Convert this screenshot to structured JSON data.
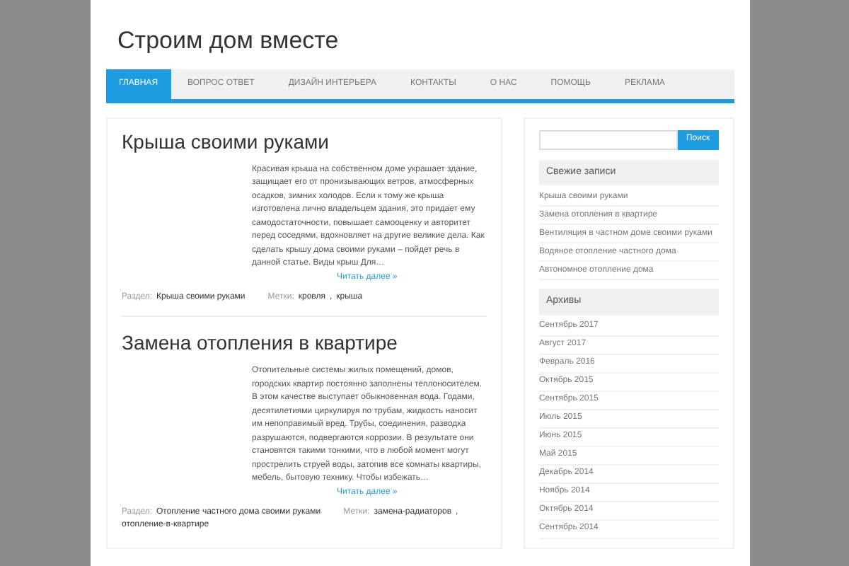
{
  "site_title": "Строим дом вместе",
  "nav": [
    {
      "label": "ГЛАВНАЯ",
      "selected": true
    },
    {
      "label": "ВОПРОС ОТВЕТ",
      "selected": false
    },
    {
      "label": "ДИЗАЙН ИНТЕРЬЕРА",
      "selected": false
    },
    {
      "label": "КОНТАКТЫ",
      "selected": false
    },
    {
      "label": "О НАС",
      "selected": false
    },
    {
      "label": "ПОМОЩЬ",
      "selected": false
    },
    {
      "label": "РЕКЛАМА",
      "selected": false
    }
  ],
  "posts": [
    {
      "title": "Крыша своими руками",
      "excerpt": "Красивая крыша на собственном доме украшает здание, защищает его от пронизывающих ветров, атмосферных осадков, зимних холодов. Если к тому же крыша изготовлена лично владельцем здания, это придает ему самодостаточности, повышает самооценку и авторитет перед соседями, вдохновляет на другие великие дела. Как сделать крышу дома своими руками – пойдет речь в данной статье. Виды крыш Для…",
      "read_more": "Читать далее »",
      "category_label": "Раздел:",
      "category": "Крыша своими руками",
      "tags_label": "Метки:",
      "tags": [
        "кровля",
        "крыша"
      ],
      "tag_separator": ","
    },
    {
      "title": "Замена отопления в квартире",
      "excerpt": "Отопительные системы жилых помещений, домов, городских квартир постоянно заполнены теплоносителем. В этом качестве выступает обыкновенная вода. Годами, десятилетиями циркулируя по трубам, жидкость наносит им непоправимый вред. Трубы, соединения, разводка разрушаются, подвергаются коррозии. В результате они становятся такими тонкими, что в любой момент могут прострелить струей воды, затопив все комнаты квартиры, мебель, бытовую технику. Чтобы избежать…",
      "read_more": "Читать далее »",
      "category_label": "Раздел:",
      "category": "Отопление частного дома своими руками",
      "tags_label": "Метки:",
      "tags": [
        "замена-радиаторов",
        "отопление-в-квартире"
      ],
      "tag_separator": ","
    }
  ],
  "search": {
    "button": "Поиск"
  },
  "widgets": [
    {
      "title": "Свежие записи",
      "items": [
        "Крыша своими руками",
        "Замена отопления в квартире",
        "Вентиляция в частном доме своими руками",
        "Водяное отопление частного дома",
        "Автономное отопление дома"
      ]
    },
    {
      "title": "Архивы",
      "items": [
        "Сентябрь 2017",
        "Август 2017",
        "Февраль 2016",
        "Октябрь 2015",
        "Сентябрь 2015",
        "Июль 2015",
        "Июнь 2015",
        "Май 2015",
        "Декабрь 2014",
        "Ноябрь 2014",
        "Октябрь 2014",
        "Сентябрь 2014"
      ]
    }
  ]
}
